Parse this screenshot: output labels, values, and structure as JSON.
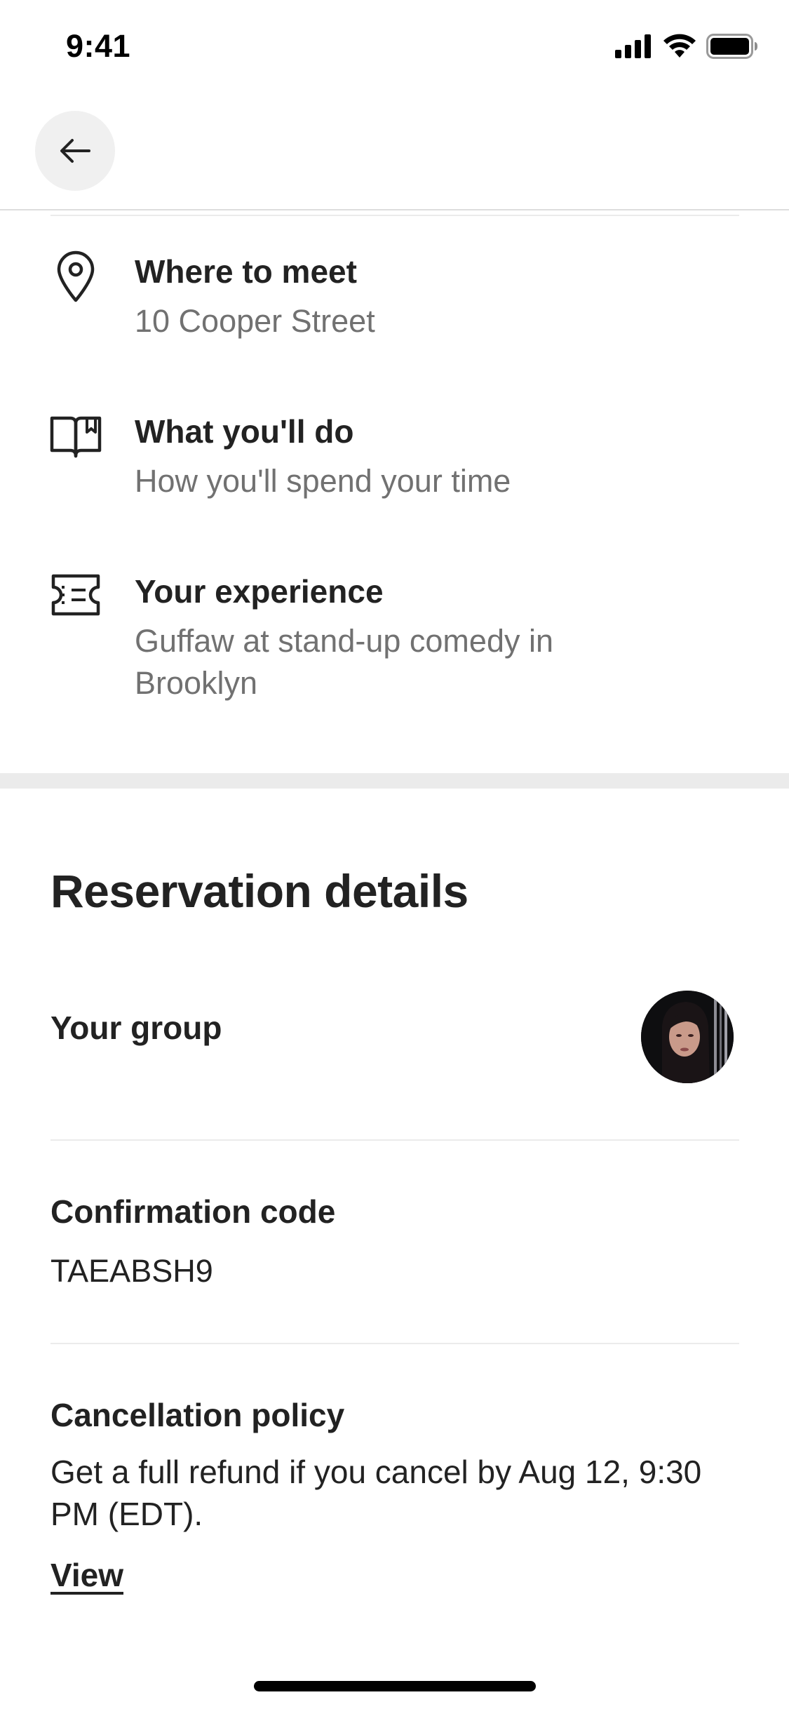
{
  "status_bar": {
    "time": "9:41",
    "icons": [
      "signal-icon",
      "wifi-icon",
      "battery-icon"
    ]
  },
  "header": {
    "back_icon": "arrow-left-icon"
  },
  "details": [
    {
      "icon": "map-pin-icon",
      "title": "Where to meet",
      "subtitle": "10 Cooper Street"
    },
    {
      "icon": "book-icon",
      "title": "What you'll do",
      "subtitle": "How you'll spend your time"
    },
    {
      "icon": "ticket-icon",
      "title": "Your experience",
      "subtitle": "Guffaw at stand-up comedy in Brooklyn"
    }
  ],
  "reservation": {
    "title": "Reservation details",
    "group_label": "Your group",
    "confirmation_label": "Confirmation code",
    "confirmation_code": "TAEABSH9",
    "cancellation_label": "Cancellation policy",
    "cancellation_text": "Get a full refund if you cancel by Aug 12, 9:30 PM (EDT).",
    "view_link": "View"
  },
  "colors": {
    "text_primary": "#222222",
    "text_secondary": "#717171",
    "divider": "#ebebeb",
    "back_button_bg": "#f0f0f0"
  }
}
